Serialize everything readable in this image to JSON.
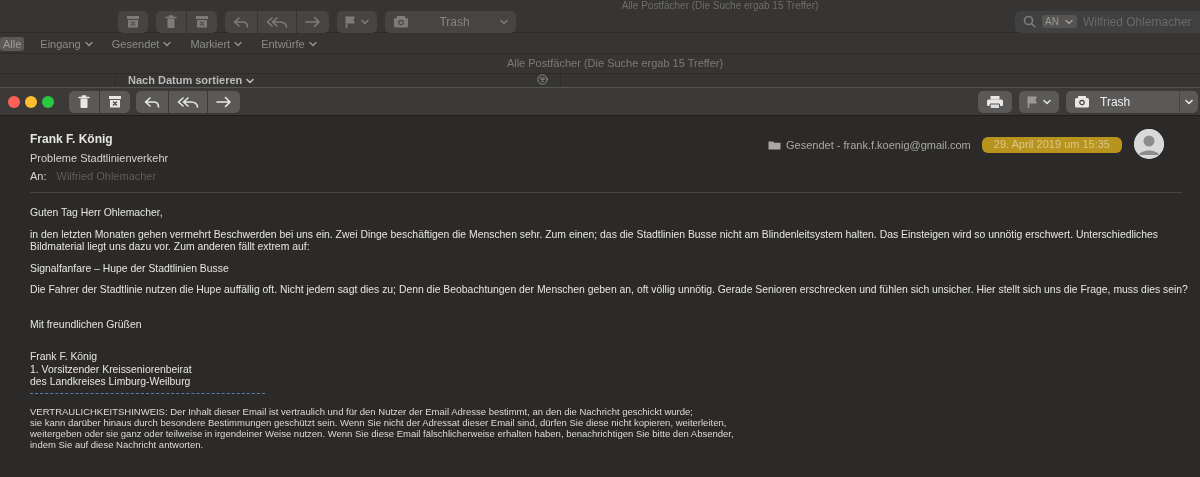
{
  "back_window": {
    "title": "Alle Postfächer (Die Suche ergab 15 Treffer)",
    "mailbox_menu": "Trash",
    "search": {
      "token": "AN",
      "value": "Wilfried Ohlemacher"
    },
    "favorites": [
      {
        "label": "Alle",
        "selected": true,
        "menu": false
      },
      {
        "label": "Eingang",
        "selected": false,
        "menu": true
      },
      {
        "label": "Gesendet",
        "selected": false,
        "menu": true
      },
      {
        "label": "Markiert",
        "selected": false,
        "menu": true
      },
      {
        "label": "Entwürfe",
        "selected": false,
        "menu": true
      }
    ],
    "status": "Alle Postfächer (Die Suche ergab 15 Treffer)",
    "sort_menu": "Nach Datum sortieren"
  },
  "message_window": {
    "mailbox_menu": "Trash",
    "header": {
      "sender": "Frank F. König",
      "subject": "Probleme Stadtlinienverkehr",
      "to_label": "An:",
      "to": "Wilfried Ohlemacher",
      "mailbox": "Gesendet - frank.f.koenig@gmail.com",
      "date": "29. April 2019 um 15:35"
    },
    "body": {
      "greeting": "Guten Tag Herr Ohlemacher,",
      "paragraphs": [
        "in den letzten Monaten gehen vermehrt Beschwerden bei uns ein. Zwei Dinge beschäftigen die Menschen sehr. Zum einen; das die Stadtlinien Busse nicht am Blindenleitsystem halten. Das Einsteigen wird so unnötig erschwert. Unterschiedliches Bildmaterial liegt uns dazu vor. Zum anderen fällt extrem auf:",
        "Signalfanfare – Hupe der Stadtlinien Busse",
        "Die Fahrer der Stadtlinie nutzen die Hupe auffällig oft. Nicht jedem sagt dies zu; Denn die Beobachtungen der Menschen geben an, oft völlig unnötig. Gerade Senioren erschrecken und fühlen sich unsicher. Hier stellt sich uns die Frage, muss dies sein?"
      ],
      "closing": "Mit freundlichen Grüßen",
      "signature": [
        "Frank F. König",
        "1. Vorsitzender Kreisseniorenbeirat",
        "des Landkreises Limburg-Weilburg"
      ],
      "disclaimer": [
        "VERTRAULICHKEITSHINWEIS: Der Inhalt dieser Email ist vertraulich und für den Nutzer der Email Adresse bestimmt, an den die Nachricht geschickt wurde;",
        "sie kann darüber hinaus durch besondere Bestimmungen geschützt sein. Wenn Sie nicht der Adressat dieser Email sind, dürfen Sie diese nicht kopieren, weiterleiten,",
        "weitergeben oder sie ganz oder teilweise in irgendeiner Weise nutzen. Wenn Sie diese Email fälschlicherweise erhalten haben, benachrichtigen Sie bitte den Absender,",
        "indem Sie auf diese Nachricht antworten."
      ]
    }
  }
}
